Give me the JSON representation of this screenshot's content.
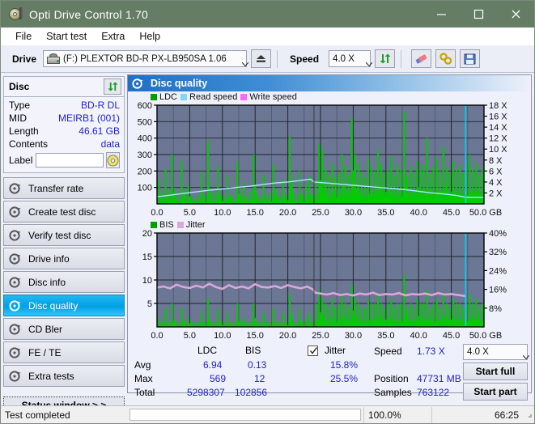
{
  "window": {
    "title": "Opti Drive Control 1.70",
    "icon": "disc-pen-icon",
    "minimize": "minimize-icon",
    "maximize": "maximize-icon",
    "close": "close-icon",
    "titlebar_color": "#657d65"
  },
  "menu": {
    "items": [
      {
        "label": "File",
        "accel": "F"
      },
      {
        "label": "Start test",
        "accel": "S"
      },
      {
        "label": "Extra",
        "accel": "x"
      },
      {
        "label": "Help",
        "accel": "H"
      }
    ]
  },
  "toolbar": {
    "drive_label": "Drive",
    "drive_value": "(F:)  PLEXTOR BD-R  PX-LB950SA 1.06",
    "eject_icon": "eject-icon",
    "speed_label": "Speed",
    "speed_value": "4.0 X",
    "refresh_icon": "refresh-icon",
    "erase_icon": "eraser-icon",
    "tools_icon": "tools-icon",
    "save_icon": "save-icon"
  },
  "disc": {
    "heading": "Disc",
    "refresh_icon": "refresh-icon",
    "rows": [
      {
        "key": "Type",
        "value": "BD-R DL"
      },
      {
        "key": "MID",
        "value": "MEIRB1 (001)"
      },
      {
        "key": "Length",
        "value": "46.61 GB"
      },
      {
        "key": "Contents",
        "value": "data"
      }
    ],
    "label_key": "Label",
    "label_value": "",
    "label_placeholder": "",
    "disc_icon": "disc-icon"
  },
  "nav": {
    "items": [
      {
        "label": "Transfer rate",
        "icon": "disc-gear-icon",
        "active": false
      },
      {
        "label": "Create test disc",
        "icon": "disc-gear-icon",
        "active": false
      },
      {
        "label": "Verify test disc",
        "icon": "disc-gear-icon",
        "active": false
      },
      {
        "label": "Drive info",
        "icon": "disc-gear-icon",
        "active": false
      },
      {
        "label": "Disc info",
        "icon": "disc-gear-icon",
        "active": false
      },
      {
        "label": "Disc quality",
        "icon": "disc-gear-icon",
        "active": true
      },
      {
        "label": "CD Bler",
        "icon": "disc-gear-icon",
        "active": false
      },
      {
        "label": "FE / TE",
        "icon": "disc-gear-icon",
        "active": false
      },
      {
        "label": "Extra tests",
        "icon": "disc-gear-icon",
        "active": false
      }
    ],
    "status_window": "Status window > >"
  },
  "panel": {
    "title": "Disc quality",
    "icon": "disc-gear-icon"
  },
  "stats": {
    "col_ldc": "LDC",
    "col_bis": "BIS",
    "jitter_label": "Jitter",
    "jitter_checked": true,
    "rows": [
      {
        "key": "Avg",
        "ldc": "6.94",
        "bis": "0.13",
        "jitter": "15.8%"
      },
      {
        "key": "Max",
        "ldc": "569",
        "bis": "12",
        "jitter": "25.5%"
      },
      {
        "key": "Total",
        "ldc": "5298307",
        "bis": "102856",
        "jitter": ""
      }
    ],
    "speed_key": "Speed",
    "speed_value": "1.73 X",
    "position_key": "Position",
    "position_value": "47731 MB",
    "samples_key": "Samples",
    "samples_value": "763122",
    "speed_select": "4.0 X",
    "start_full": "Start full",
    "start_part": "Start part"
  },
  "statusbar": {
    "message": "Test completed",
    "percent_label": "100.0%",
    "percent_value": 100,
    "elapsed": "66:25"
  },
  "colors": {
    "ldc_green": "#00cc00",
    "read_speed_cyan": "#7fd8f7",
    "write_speed_magenta": "#ff66ff",
    "bis_green": "#00cc00",
    "jitter_pink": "#d9a8d9",
    "plot_bg": "#6b7794",
    "accent_blue": "#2222cc"
  },
  "chart_data": [
    {
      "type": "bar",
      "id": "disc-quality-ldc",
      "title": "",
      "xlabel": "GB",
      "ylabel": "",
      "xlim": [
        0.0,
        50.0
      ],
      "xticks": [
        "0.0",
        "5.0",
        "10.0",
        "15.0",
        "20.0",
        "25.0",
        "30.0",
        "35.0",
        "40.0",
        "45.0",
        "50.0 GB"
      ],
      "ylim": [
        0,
        600
      ],
      "yticks": [
        100,
        200,
        300,
        400,
        500,
        600
      ],
      "y2lim": [
        0,
        18
      ],
      "y2ticks": [
        "2 X",
        "4 X",
        "6 X",
        "8 X",
        "10 X",
        "12 X",
        "14 X",
        "16 X",
        "18 X"
      ],
      "grid": true,
      "legend": [
        {
          "name": "LDC",
          "color": "#00a000"
        },
        {
          "name": "Read speed",
          "color": "#7fd8f7"
        },
        {
          "name": "Write speed",
          "color": "#ff66ff"
        }
      ],
      "series": [
        {
          "name": "LDC",
          "kind": "bars",
          "color": "#00cc00",
          "note": "dense green error spikes across whole disc; baseline rises sharply after 24 GB",
          "x": [
            0.3,
            0.8,
            1.3,
            1.8,
            2.3,
            2.8,
            3.3,
            3.8,
            4.3,
            4.8,
            5.3,
            5.8,
            6.3,
            6.8,
            7.3,
            7.8,
            8.3,
            8.8,
            9.3,
            9.8,
            10.3,
            10.8,
            11.3,
            11.8,
            12.3,
            12.8,
            13.3,
            13.8,
            14.3,
            14.8,
            15.3,
            15.8,
            16.3,
            16.8,
            17.3,
            17.8,
            18.3,
            18.8,
            19.3,
            19.8,
            20.3,
            20.8,
            21.3,
            21.8,
            22.3,
            22.8,
            23.3,
            23.8,
            24.3,
            24.8,
            25.3,
            25.8,
            26.3,
            26.8,
            27.3,
            27.8,
            28.3,
            28.8,
            29.3,
            29.8,
            30.3,
            30.8,
            31.3,
            31.8,
            32.3,
            32.8,
            33.3,
            33.8,
            34.3,
            34.8,
            35.3,
            35.8,
            36.3,
            36.8,
            37.3,
            37.8,
            38.3,
            38.8,
            39.3,
            39.8,
            40.3,
            40.8,
            41.3,
            41.8,
            42.3,
            42.8,
            43.3,
            43.8,
            44.3,
            44.8,
            45.3,
            45.8,
            46.3,
            46.8,
            47.3,
            47.8,
            48.3,
            48.8,
            49.3,
            49.8
          ],
          "values": [
            150,
            60,
            210,
            90,
            300,
            70,
            40,
            260,
            55,
            120,
            40,
            35,
            60,
            190,
            45,
            380,
            50,
            70,
            230,
            50,
            45,
            170,
            60,
            40,
            260,
            55,
            130,
            45,
            80,
            300,
            60,
            40,
            180,
            50,
            70,
            240,
            90,
            50,
            150,
            60,
            410,
            70,
            45,
            200,
            55,
            120,
            170,
            60,
            150,
            370,
            330,
            210,
            180,
            250,
            160,
            190,
            300,
            230,
            180,
            520,
            300,
            250,
            190,
            160,
            280,
            220,
            200,
            330,
            240,
            190,
            210,
            290,
            180,
            240,
            210,
            560,
            170,
            230,
            190,
            260,
            210,
            240,
            400,
            190,
            230,
            280,
            200,
            350,
            220,
            190,
            260,
            210,
            240,
            190,
            230,
            300,
            210,
            250,
            180,
            220
          ]
        },
        {
          "name": "Read speed",
          "kind": "line",
          "color": "#a8e8ff",
          "axis": "y2",
          "note": "CAV ramp rising 1.3X to ~4.5X up to 24 GB, then drops and descends 4.0X to 1.2X",
          "x": [
            0.0,
            2.0,
            4.0,
            6.0,
            8.0,
            10.0,
            12.0,
            14.0,
            16.0,
            18.0,
            20.0,
            22.0,
            23.5,
            24.0,
            26.0,
            28.0,
            30.0,
            32.0,
            34.0,
            36.0,
            38.0,
            40.0,
            42.0,
            44.0,
            46.0,
            47.2,
            50.0
          ],
          "values": [
            1.3,
            1.6,
            1.9,
            2.2,
            2.5,
            2.7,
            3.0,
            3.2,
            3.5,
            3.8,
            4.0,
            4.3,
            4.5,
            4.0,
            3.8,
            3.6,
            3.4,
            3.2,
            3.0,
            2.8,
            2.6,
            2.3,
            2.0,
            1.8,
            1.5,
            1.2,
            1.2
          ]
        }
      ],
      "markers": [
        {
          "name": "layer-break",
          "x": 24.0,
          "color": "#3a3a3a"
        },
        {
          "name": "end-of-data",
          "x": 47.2,
          "color": "#00d4ff"
        }
      ]
    },
    {
      "type": "bar",
      "id": "disc-quality-bis-jitter",
      "title": "",
      "xlabel": "GB",
      "ylabel": "",
      "xlim": [
        0.0,
        50.0
      ],
      "xticks": [
        "0.0",
        "5.0",
        "10.0",
        "15.0",
        "20.0",
        "25.0",
        "30.0",
        "35.0",
        "40.0",
        "45.0",
        "50.0 GB"
      ],
      "ylim": [
        0,
        20
      ],
      "yticks": [
        5,
        10,
        15,
        20
      ],
      "y2lim": [
        0,
        40
      ],
      "y2ticks": [
        "8%",
        "16%",
        "24%",
        "32%",
        "40%"
      ],
      "grid": true,
      "legend": [
        {
          "name": "BIS",
          "color": "#00a000"
        },
        {
          "name": "Jitter",
          "color": "#d9a8d9"
        }
      ],
      "series": [
        {
          "name": "BIS",
          "kind": "bars",
          "color": "#00cc00",
          "note": "low spikes (0-7) over first 24 GB then a dense solid band 3-8 after the layer break",
          "x": [
            0.3,
            0.8,
            1.3,
            1.8,
            2.3,
            2.8,
            3.3,
            3.8,
            4.3,
            4.8,
            5.3,
            5.8,
            6.3,
            6.8,
            7.3,
            7.8,
            8.3,
            8.8,
            9.3,
            9.8,
            10.3,
            10.8,
            11.3,
            11.8,
            12.3,
            12.8,
            13.3,
            13.8,
            14.3,
            14.8,
            15.3,
            15.8,
            16.3,
            16.8,
            17.3,
            17.8,
            18.3,
            18.8,
            19.3,
            19.8,
            20.3,
            20.8,
            21.3,
            21.8,
            22.3,
            22.8,
            23.3,
            23.8,
            24.3,
            24.8,
            25.3,
            25.8,
            26.3,
            26.8,
            27.3,
            27.8,
            28.3,
            28.8,
            29.3,
            29.8,
            30.3,
            30.8,
            31.3,
            31.8,
            32.3,
            32.8,
            33.3,
            33.8,
            34.3,
            34.8,
            35.3,
            35.8,
            36.3,
            36.8,
            37.3,
            37.8,
            38.3,
            38.8,
            39.3,
            39.8,
            40.3,
            40.8,
            41.3,
            41.8,
            42.3,
            42.8,
            43.3,
            43.8,
            44.3,
            44.8,
            45.3,
            45.8,
            46.3,
            46.8,
            47.3,
            47.8,
            48.3,
            48.8,
            49.3,
            49.8
          ],
          "values": [
            2,
            1,
            4,
            1,
            5,
            1,
            1,
            4,
            1,
            2,
            1,
            1,
            1,
            3,
            1,
            6,
            1,
            1,
            4,
            1,
            1,
            3,
            1,
            1,
            5,
            1,
            2,
            1,
            1,
            5,
            1,
            1,
            3,
            1,
            1,
            4,
            1,
            1,
            3,
            1,
            7,
            1,
            1,
            4,
            1,
            2,
            3,
            1,
            5,
            8,
            6,
            5,
            4,
            6,
            4,
            5,
            7,
            5,
            4,
            9,
            6,
            5,
            4,
            4,
            6,
            5,
            5,
            7,
            5,
            4,
            5,
            6,
            4,
            5,
            5,
            11,
            4,
            5,
            4,
            6,
            5,
            5,
            8,
            4,
            5,
            6,
            4,
            7,
            5,
            4,
            6,
            5,
            5,
            4,
            5,
            7,
            5,
            6,
            4,
            5
          ]
        },
        {
          "name": "Jitter",
          "kind": "line",
          "color": "#d9a8d9",
          "axis": "y2",
          "note": "noisy band averaging ~15.8% (peaks to 25.5%) for the first 24 GB, then a tighter band near 13-15%",
          "x": [
            0.0,
            1.0,
            2.0,
            3.0,
            4.0,
            5.0,
            6.0,
            7.0,
            8.0,
            9.0,
            10.0,
            11.0,
            12.0,
            13.0,
            14.0,
            15.0,
            16.0,
            17.0,
            18.0,
            19.0,
            20.0,
            21.0,
            22.0,
            23.0,
            23.8,
            24.2,
            25.0,
            26.0,
            27.0,
            28.0,
            29.0,
            30.0,
            31.0,
            32.0,
            33.0,
            34.0,
            35.0,
            36.0,
            37.0,
            38.0,
            39.0,
            40.0,
            41.0,
            42.0,
            43.0,
            44.0,
            45.0,
            46.0,
            47.0,
            47.2
          ],
          "values": [
            16.8,
            17.2,
            16.4,
            18.0,
            17.0,
            16.6,
            17.6,
            16.8,
            18.4,
            17.0,
            16.2,
            17.8,
            16.6,
            17.2,
            16.4,
            18.2,
            17.0,
            16.8,
            17.4,
            16.6,
            17.8,
            17.0,
            16.4,
            17.2,
            16.0,
            14.6,
            14.2,
            13.8,
            14.4,
            13.6,
            14.0,
            13.4,
            14.2,
            13.8,
            14.6,
            13.6,
            14.0,
            13.8,
            14.4,
            13.4,
            14.0,
            13.8,
            14.2,
            13.6,
            14.4,
            13.8,
            14.0,
            13.6,
            13.2,
            13.0
          ]
        }
      ],
      "markers": [
        {
          "name": "layer-break",
          "x": 24.0,
          "color": "#3a3a3a"
        },
        {
          "name": "end-of-data",
          "x": 47.2,
          "color": "#00d4ff"
        }
      ]
    }
  ]
}
